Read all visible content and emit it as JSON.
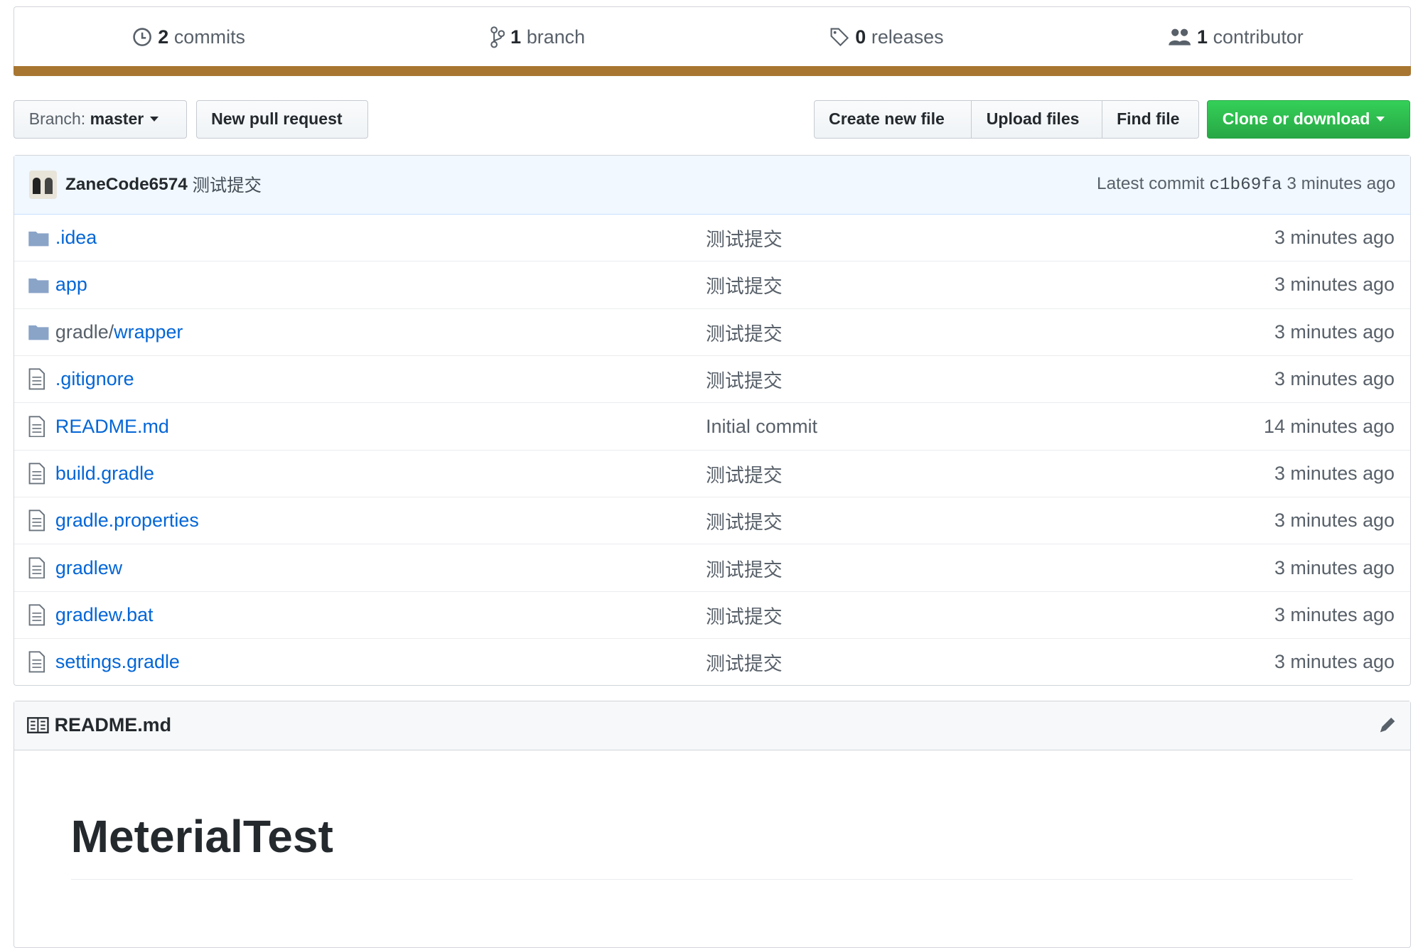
{
  "summary": {
    "commits": {
      "count": "2",
      "label": "commits"
    },
    "branches": {
      "count": "1",
      "label": "branch"
    },
    "releases": {
      "count": "0",
      "label": "releases"
    },
    "contributors": {
      "count": "1",
      "label": "contributor"
    },
    "language_color": "#a87631"
  },
  "toolbar": {
    "branch_prefix": "Branch:",
    "branch": "master",
    "new_pr": "New pull request",
    "create_file": "Create new file",
    "upload": "Upload files",
    "find": "Find file",
    "clone": "Clone or download"
  },
  "commit": {
    "author": "ZaneCode6574",
    "message": "测试提交",
    "latest_label": "Latest commit",
    "sha": "c1b69fa",
    "age": "3 minutes ago"
  },
  "files": [
    {
      "type": "dir",
      "prefix": "",
      "name": ".idea",
      "message": "测试提交",
      "age": "3 minutes ago"
    },
    {
      "type": "dir",
      "prefix": "",
      "name": "app",
      "message": "测试提交",
      "age": "3 minutes ago"
    },
    {
      "type": "dir",
      "prefix": "gradle/",
      "name": "wrapper",
      "message": "测试提交",
      "age": "3 minutes ago"
    },
    {
      "type": "file",
      "prefix": "",
      "name": ".gitignore",
      "message": "测试提交",
      "age": "3 minutes ago"
    },
    {
      "type": "file",
      "prefix": "",
      "name": "README.md",
      "message": "Initial commit",
      "age": "14 minutes ago"
    },
    {
      "type": "file",
      "prefix": "",
      "name": "build.gradle",
      "message": "测试提交",
      "age": "3 minutes ago"
    },
    {
      "type": "file",
      "prefix": "",
      "name": "gradle.properties",
      "message": "测试提交",
      "age": "3 minutes ago"
    },
    {
      "type": "file",
      "prefix": "",
      "name": "gradlew",
      "message": "测试提交",
      "age": "3 minutes ago"
    },
    {
      "type": "file",
      "prefix": "",
      "name": "gradlew.bat",
      "message": "测试提交",
      "age": "3 minutes ago"
    },
    {
      "type": "file",
      "prefix": "",
      "name": "settings.gradle",
      "message": "测试提交",
      "age": "3 minutes ago"
    }
  ],
  "readme": {
    "filename": "README.md",
    "heading": "MeterialTest"
  }
}
